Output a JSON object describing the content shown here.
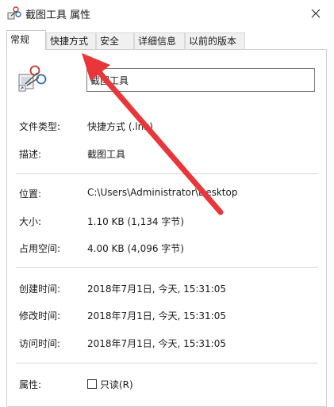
{
  "window": {
    "title": "截图工具 属性"
  },
  "tabs": [
    {
      "label": "常规"
    },
    {
      "label": "快捷方式"
    },
    {
      "label": "安全"
    },
    {
      "label": "详细信息"
    },
    {
      "label": "以前的版本"
    }
  ],
  "general": {
    "name_value": "截图工具",
    "file_type_label": "文件类型:",
    "file_type_value": "快捷方式 (.lnk)",
    "description_label": "描述:",
    "description_value": "截图工具",
    "location_label": "位置:",
    "location_value": "C:\\Users\\Administrator\\Desktop",
    "size_label": "大小:",
    "size_value": "1.10 KB (1,134 字节)",
    "size_on_disk_label": "占用空间:",
    "size_on_disk_value": "4.00 KB (4,096 字节)",
    "created_label": "创建时间:",
    "created_value": "2018年7月1日, 今天, 15:31:05",
    "modified_label": "修改时间:",
    "modified_value": "2018年7月1日, 今天, 15:31:05",
    "accessed_label": "访问时间:",
    "accessed_value": "2018年7月1日, 今天, 15:31:05",
    "attributes_label": "属性:",
    "readonly_label": "只读(R)"
  },
  "annotation": {
    "arrow_color": "#e8363a"
  },
  "icons": {
    "app": "snipping-tool-icon",
    "close": "close-icon"
  }
}
